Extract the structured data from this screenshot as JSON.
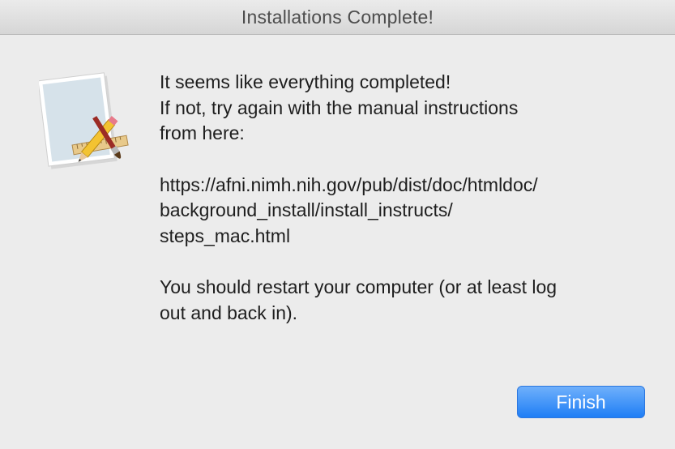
{
  "window": {
    "title": "Installations Complete!"
  },
  "dialog": {
    "icon": "script-editor-icon",
    "lines_intro": "It seems like everything completed!\nIf not, try again with the manual instructions\nfrom here:",
    "url": "https://afni.nimh.nih.gov/pub/dist/doc/htmldoc/\nbackground_install/install_instructs/\nsteps_mac.html",
    "restart_note": "You should restart your computer (or at least log\nout and back in)."
  },
  "buttons": {
    "finish_label": "Finish"
  },
  "colors": {
    "accent": "#1f7ef5",
    "background": "#ececec"
  }
}
